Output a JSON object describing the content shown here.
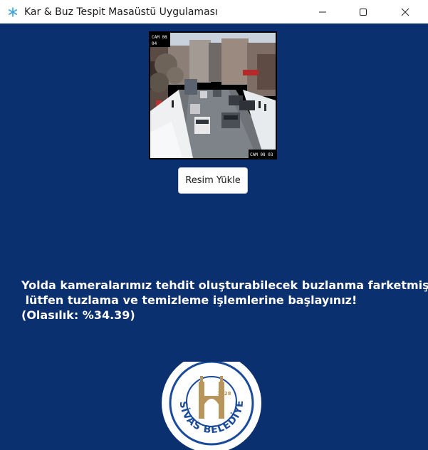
{
  "window": {
    "title": "Kar & Buz Tespit Masaüstü Uygulaması",
    "app_icon": "snowflake-icon",
    "controls": [
      "minimize-icon",
      "maximize-icon",
      "close-icon"
    ]
  },
  "camera": {
    "overlay_top_left_line1": "CAM 08",
    "overlay_top_left_line2": "04",
    "overlay_bottom_right": "CAM 08 03"
  },
  "toolbar": {
    "upload_label": "Resim Yükle"
  },
  "result": {
    "line1": "Yolda kameralarımız tehdit oluşturabilecek buzlanma farketmiştir,",
    "line2": " lütfen tuzlama ve temizleme işlemlerine başlayınız!",
    "line3": "(Olasılık: %34.39)"
  },
  "logo": {
    "text": "SİVAS BELEDİYESİ",
    "year": "1828"
  },
  "colors": {
    "background": "#0b3070",
    "logo_blue": "#1a4a9a",
    "logo_gold": "#b8955a"
  }
}
